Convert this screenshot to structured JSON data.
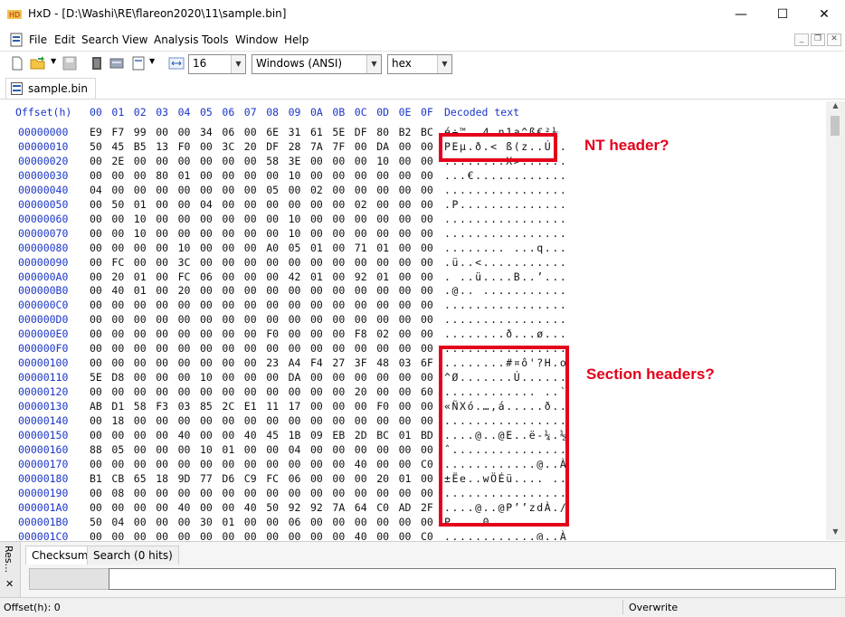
{
  "window": {
    "title": "HxD - [D:\\Washi\\RE\\flareon2020\\11\\sample.bin]",
    "minimize": "—",
    "maximize": "☐",
    "close": "✕"
  },
  "menu": [
    "File",
    "Edit",
    "Search",
    "View",
    "Analysis",
    "Tools",
    "Window",
    "Help"
  ],
  "toolbar": {
    "bytes_per_row": "16",
    "charset": "Windows (ANSI)",
    "display": "hex"
  },
  "tab": {
    "label": "sample.bin"
  },
  "hex": {
    "offset_header": "Offset(h)",
    "column_headers": [
      "00",
      "01",
      "02",
      "03",
      "04",
      "05",
      "06",
      "07",
      "08",
      "09",
      "0A",
      "0B",
      "0C",
      "0D",
      "0E",
      "0F"
    ],
    "decoded_header": "Decoded text",
    "rows": [
      {
        "offset": "00000000",
        "bytes": [
          "E9",
          "F7",
          "99",
          "00",
          "00",
          "34",
          "06",
          "00",
          "6E",
          "31",
          "61",
          "5E",
          "DF",
          "80",
          "B2",
          "BC"
        ],
        "text": "é÷™..4.n1a^ß€²¼"
      },
      {
        "offset": "00000010",
        "bytes": [
          "50",
          "45",
          "B5",
          "13",
          "F0",
          "00",
          "3C",
          "20",
          "DF",
          "28",
          "7A",
          "7F",
          "00",
          "DA",
          "00",
          "00"
        ],
        "text": "PEµ.ð.< ß(z..Ú.."
      },
      {
        "offset": "00000020",
        "bytes": [
          "00",
          "2E",
          "00",
          "00",
          "00",
          "00",
          "00",
          "00",
          "58",
          "3E",
          "00",
          "00",
          "00",
          "10",
          "00",
          "00"
        ],
        "text": "........X>......"
      },
      {
        "offset": "00000030",
        "bytes": [
          "00",
          "00",
          "00",
          "80",
          "01",
          "00",
          "00",
          "00",
          "00",
          "10",
          "00",
          "00",
          "00",
          "00",
          "00",
          "00"
        ],
        "text": "...€............"
      },
      {
        "offset": "00000040",
        "bytes": [
          "04",
          "00",
          "00",
          "00",
          "00",
          "00",
          "00",
          "00",
          "05",
          "00",
          "02",
          "00",
          "00",
          "00",
          "00",
          "00"
        ],
        "text": "................"
      },
      {
        "offset": "00000050",
        "bytes": [
          "00",
          "50",
          "01",
          "00",
          "00",
          "04",
          "00",
          "00",
          "00",
          "00",
          "00",
          "00",
          "02",
          "00",
          "00",
          "00"
        ],
        "text": ".P.............."
      },
      {
        "offset": "00000060",
        "bytes": [
          "00",
          "00",
          "10",
          "00",
          "00",
          "00",
          "00",
          "00",
          "00",
          "10",
          "00",
          "00",
          "00",
          "00",
          "00",
          "00"
        ],
        "text": "................"
      },
      {
        "offset": "00000070",
        "bytes": [
          "00",
          "00",
          "10",
          "00",
          "00",
          "00",
          "00",
          "00",
          "00",
          "10",
          "00",
          "00",
          "00",
          "00",
          "00",
          "00"
        ],
        "text": "................"
      },
      {
        "offset": "00000080",
        "bytes": [
          "00",
          "00",
          "00",
          "00",
          "10",
          "00",
          "00",
          "00",
          "A0",
          "05",
          "01",
          "00",
          "71",
          "01",
          "00",
          "00"
        ],
        "text": "........ ...q..."
      },
      {
        "offset": "00000090",
        "bytes": [
          "00",
          "FC",
          "00",
          "00",
          "3C",
          "00",
          "00",
          "00",
          "00",
          "00",
          "00",
          "00",
          "00",
          "00",
          "00",
          "00"
        ],
        "text": ".ü..<..........."
      },
      {
        "offset": "000000A0",
        "bytes": [
          "00",
          "20",
          "01",
          "00",
          "FC",
          "06",
          "00",
          "00",
          "00",
          "42",
          "01",
          "00",
          "92",
          "01",
          "00",
          "00"
        ],
        "text": ". ..ü....B..’..."
      },
      {
        "offset": "000000B0",
        "bytes": [
          "00",
          "40",
          "01",
          "00",
          "20",
          "00",
          "00",
          "00",
          "00",
          "00",
          "00",
          "00",
          "00",
          "00",
          "00",
          "00"
        ],
        "text": ".@.. ..........."
      },
      {
        "offset": "000000C0",
        "bytes": [
          "00",
          "00",
          "00",
          "00",
          "00",
          "00",
          "00",
          "00",
          "00",
          "00",
          "00",
          "00",
          "00",
          "00",
          "00",
          "00"
        ],
        "text": "................"
      },
      {
        "offset": "000000D0",
        "bytes": [
          "00",
          "00",
          "00",
          "00",
          "00",
          "00",
          "00",
          "00",
          "00",
          "00",
          "00",
          "00",
          "00",
          "00",
          "00",
          "00"
        ],
        "text": "................"
      },
      {
        "offset": "000000E0",
        "bytes": [
          "00",
          "00",
          "00",
          "00",
          "00",
          "00",
          "00",
          "00",
          "F0",
          "00",
          "00",
          "00",
          "F8",
          "02",
          "00",
          "00"
        ],
        "text": "........ð...ø..."
      },
      {
        "offset": "000000F0",
        "bytes": [
          "00",
          "00",
          "00",
          "00",
          "00",
          "00",
          "00",
          "00",
          "00",
          "00",
          "00",
          "00",
          "00",
          "00",
          "00",
          "00"
        ],
        "text": "................"
      },
      {
        "offset": "00000100",
        "bytes": [
          "00",
          "00",
          "00",
          "00",
          "00",
          "00",
          "00",
          "00",
          "23",
          "A4",
          "F4",
          "27",
          "3F",
          "48",
          "03",
          "6F"
        ],
        "text": "........#¤ô'?H.o"
      },
      {
        "offset": "00000110",
        "bytes": [
          "5E",
          "D8",
          "00",
          "00",
          "00",
          "10",
          "00",
          "00",
          "00",
          "DA",
          "00",
          "00",
          "00",
          "00",
          "00",
          "00"
        ],
        "text": "^Ø.......Ú......"
      },
      {
        "offset": "00000120",
        "bytes": [
          "00",
          "00",
          "00",
          "00",
          "00",
          "00",
          "00",
          "00",
          "00",
          "00",
          "00",
          "00",
          "20",
          "00",
          "00",
          "60"
        ],
        "text": "............ ..`"
      },
      {
        "offset": "00000130",
        "bytes": [
          "AB",
          "D1",
          "58",
          "F3",
          "03",
          "85",
          "2C",
          "E1",
          "11",
          "17",
          "00",
          "00",
          "00",
          "F0",
          "00",
          "00"
        ],
        "text": "«ÑXó.…,á.....ð.."
      },
      {
        "offset": "00000140",
        "bytes": [
          "00",
          "18",
          "00",
          "00",
          "00",
          "00",
          "00",
          "00",
          "00",
          "00",
          "00",
          "00",
          "00",
          "00",
          "00",
          "00"
        ],
        "text": "................"
      },
      {
        "offset": "00000150",
        "bytes": [
          "00",
          "00",
          "00",
          "00",
          "40",
          "00",
          "00",
          "40",
          "45",
          "1B",
          "09",
          "EB",
          "2D",
          "BC",
          "01",
          "BD"
        ],
        "text": "....@..@E..ë-¼.½"
      },
      {
        "offset": "00000160",
        "bytes": [
          "88",
          "05",
          "00",
          "00",
          "00",
          "10",
          "01",
          "00",
          "00",
          "04",
          "00",
          "00",
          "00",
          "00",
          "00",
          "00"
        ],
        "text": "ˆ..............."
      },
      {
        "offset": "00000170",
        "bytes": [
          "00",
          "00",
          "00",
          "00",
          "00",
          "00",
          "00",
          "00",
          "00",
          "00",
          "00",
          "00",
          "40",
          "00",
          "00",
          "C0"
        ],
        "text": "............@..À"
      },
      {
        "offset": "00000180",
        "bytes": [
          "B1",
          "CB",
          "65",
          "18",
          "9D",
          "77",
          "D6",
          "C9",
          "FC",
          "06",
          "00",
          "00",
          "00",
          "20",
          "01",
          "00"
        ],
        "text": "±Ëe..wÖÉü.... .."
      },
      {
        "offset": "00000190",
        "bytes": [
          "00",
          "08",
          "00",
          "00",
          "00",
          "00",
          "00",
          "00",
          "00",
          "00",
          "00",
          "00",
          "00",
          "00",
          "00",
          "00"
        ],
        "text": "................"
      },
      {
        "offset": "000001A0",
        "bytes": [
          "00",
          "00",
          "00",
          "00",
          "40",
          "00",
          "00",
          "40",
          "50",
          "92",
          "92",
          "7A",
          "64",
          "C0",
          "AD",
          "2F"
        ],
        "text": "....@..@P’’zdÀ./"
      },
      {
        "offset": "000001B0",
        "bytes": [
          "50",
          "04",
          "00",
          "00",
          "00",
          "30",
          "01",
          "00",
          "00",
          "06",
          "00",
          "00",
          "00",
          "00",
          "00",
          "00"
        ],
        "text": "P....0.........."
      },
      {
        "offset": "000001C0",
        "bytes": [
          "00",
          "00",
          "00",
          "00",
          "00",
          "00",
          "00",
          "00",
          "00",
          "00",
          "00",
          "00",
          "40",
          "00",
          "00",
          "C0"
        ],
        "text": "............@..À"
      }
    ]
  },
  "annotations": {
    "nt_header": "NT header?",
    "section_headers": "Section headers?"
  },
  "accent_color": "#e4001b",
  "bottom_panel": {
    "side_label": "Res...",
    "side_close": "✕",
    "tabs": [
      "Checksum",
      "Search (0 hits)"
    ]
  },
  "status": {
    "offset": "Offset(h): 0",
    "mode": "Overwrite"
  }
}
